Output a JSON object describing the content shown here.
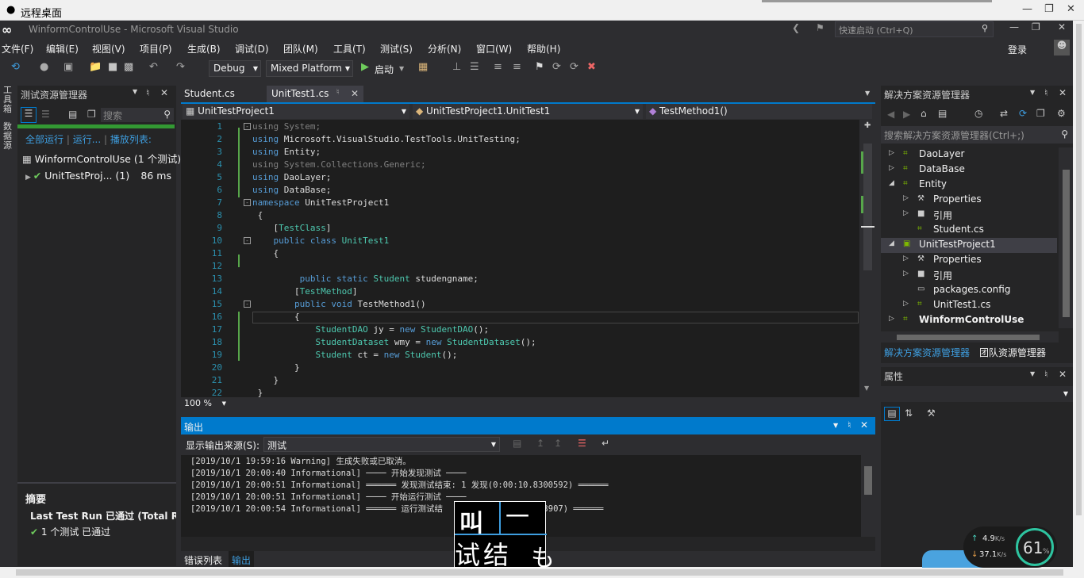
{
  "rdp": {
    "title": "远程桌面"
  },
  "window": {
    "title": "WinformControlUse - Microsoft Visual Studio",
    "quick_launch": "快速启动 (Ctrl+Q)",
    "login": "登录"
  },
  "menu": [
    "文件(F)",
    "编辑(E)",
    "视图(V)",
    "项目(P)",
    "生成(B)",
    "调试(D)",
    "团队(M)",
    "工具(T)",
    "测试(S)",
    "分析(N)",
    "窗口(W)",
    "帮助(H)"
  ],
  "toolbar": {
    "config": "Debug",
    "platform": "Mixed Platform",
    "start": "启动"
  },
  "left_strip": {
    "a": "工具箱",
    "b": "数据源"
  },
  "test_explorer": {
    "title": "测试资源管理器",
    "search_placeholder": "搜索",
    "run_all": "全部运行",
    "run": "运行...",
    "playlist": "播放列表:",
    "root": "WinformControlUse (1 个测试)",
    "child": "UnitTestProj... (1)",
    "child_time": "86 ms",
    "summary_title": "摘要",
    "last_run": "Last Test Run 已通过 (Total Run",
    "passed": "1 个测试 已通过"
  },
  "editor": {
    "tabs": [
      "Student.cs",
      "UnitTest1.cs"
    ],
    "nav": [
      "UnitTestProject1",
      "UnitTestProject1.UnitTest1",
      "TestMethod1()"
    ],
    "zoom": "100 %",
    "lines": [
      {
        "n": "1",
        "t": "using System;"
      },
      {
        "n": "2",
        "t": "using Microsoft.VisualStudio.TestTools.UnitTesting;"
      },
      {
        "n": "3",
        "t": "using Entity;"
      },
      {
        "n": "4",
        "t": "using System.Collections.Generic;"
      },
      {
        "n": "5",
        "t": "using DaoLayer;"
      },
      {
        "n": "6",
        "t": "using DataBase;"
      },
      {
        "n": "7",
        "t": "namespace UnitTestProject1"
      },
      {
        "n": "8",
        "t": " {"
      },
      {
        "n": "9",
        "t": "    [TestClass]"
      },
      {
        "n": "10",
        "t": "    public class UnitTest1"
      },
      {
        "n": "11",
        "t": "    {"
      },
      {
        "n": "12",
        "t": ""
      },
      {
        "n": "13",
        "t": "         public static Student studengname;"
      },
      {
        "n": "14",
        "t": "        [TestMethod]"
      },
      {
        "n": "15",
        "t": "        public void TestMethod1()"
      },
      {
        "n": "16",
        "t": "        {"
      },
      {
        "n": "17",
        "t": "            StudentDAO jy = new StudentDAO();"
      },
      {
        "n": "18",
        "t": "            StudentDataset wmy = new StudentDataset();"
      },
      {
        "n": "19",
        "t": "            Student ct = new Student();"
      },
      {
        "n": "20",
        "t": "        }"
      },
      {
        "n": "21",
        "t": "    }"
      },
      {
        "n": "22",
        "t": " }"
      }
    ]
  },
  "output": {
    "title": "输出",
    "source_label": "显示输出来源(S):",
    "source_value": "测试",
    "lines": [
      "[2019/10/1 19:59:16 Warning] 生成失败或已取消。",
      "[2019/10/1 20:00:40 Informational] ──── 开始发现测试 ────",
      "[2019/10/1 20:00:51 Informational] ══════ 发现测试结束: 1 发现(0:00:10.8300592) ══════",
      "[2019/10/1 20:00:51 Informational] ──── 开始运行测试 ────",
      "[2019/10/1 20:00:54 Informational] ══════ 运行测试结                 9583907) ══════"
    ],
    "bottom_tabs": [
      "错误列表",
      "输出"
    ]
  },
  "solution_explorer": {
    "title": "解决方案资源管理器",
    "search": "搜索解决方案资源管理器(Ctrl+;)",
    "items": [
      {
        "label": "DaoLayer",
        "indent": 0,
        "icon": "C#"
      },
      {
        "label": "DataBase",
        "indent": 0,
        "icon": "C#"
      },
      {
        "label": "Entity",
        "indent": 0,
        "icon": "C#"
      },
      {
        "label": "Properties",
        "indent": 1,
        "icon": "wrench"
      },
      {
        "label": "引用",
        "indent": 1,
        "icon": "ref"
      },
      {
        "label": "Student.cs",
        "indent": 1,
        "icon": "C#"
      },
      {
        "label": "UnitTestProject1",
        "indent": 0,
        "icon": "test"
      },
      {
        "label": "Properties",
        "indent": 1,
        "icon": "wrench"
      },
      {
        "label": "引用",
        "indent": 1,
        "icon": "ref"
      },
      {
        "label": "packages.config",
        "indent": 1,
        "icon": "file"
      },
      {
        "label": "UnitTest1.cs",
        "indent": 1,
        "icon": "C#"
      },
      {
        "label": "WinformControlUse",
        "indent": 0,
        "icon": "C#"
      }
    ],
    "tabs": [
      "解决方案资源管理器",
      "团队资源管理器"
    ]
  },
  "properties": {
    "title": "属性"
  },
  "overlay": {
    "up": "4.9",
    "down": "37.1",
    "unit": "K/s",
    "percent": "61",
    "percent_unit": "%",
    "ime_top": "一",
    "ime_bottom": "试结",
    "ime_left": "叫"
  },
  "colors": {
    "accent": "#007acc",
    "pass": "#339933"
  }
}
